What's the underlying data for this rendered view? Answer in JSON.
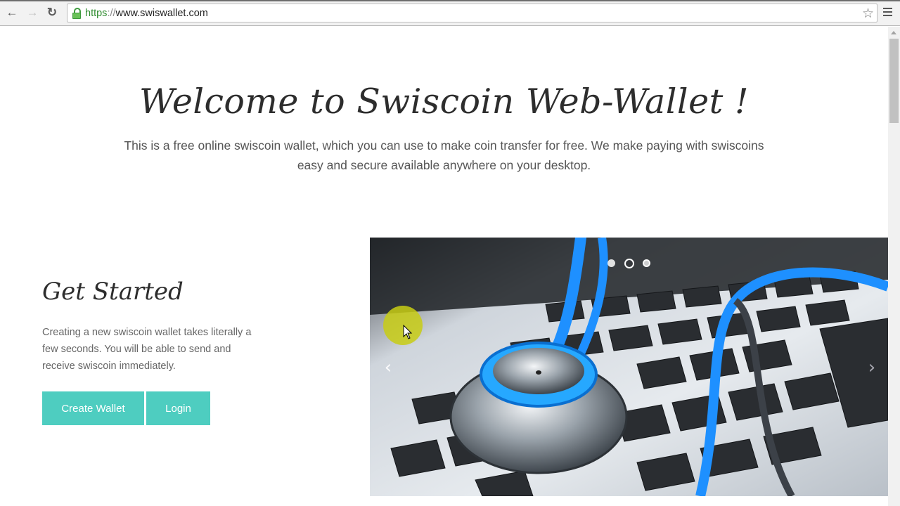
{
  "browser": {
    "url_scheme": "https",
    "url_separator": "://",
    "url_host": "www.swiswallet.com",
    "back_icon": "←",
    "forward_icon": "→",
    "reload_icon": "↻",
    "bookmark_icon": "☆"
  },
  "hero": {
    "title": "Welcome to Swiscoin Web-Wallet !",
    "subtitle": "This is a free online swiscoin wallet, which you can use to make coin transfer for free. We make paying with swiscoins easy and secure available anywhere on your desktop."
  },
  "get_started": {
    "title": "Get Started",
    "text": "Creating a new swiscoin wallet takes literally a few seconds. You will be able to send and receive swiscoin immediately.",
    "create_label": "Create Wallet",
    "login_label": "Login"
  },
  "carousel": {
    "prev_icon": "‹",
    "next_icon": "›",
    "slide_count": 3,
    "active_index": 1,
    "image_description": "stethoscope on laptop keyboard"
  },
  "colors": {
    "accent": "#4ecdc0",
    "cursor_highlight": "#c8cd14"
  }
}
